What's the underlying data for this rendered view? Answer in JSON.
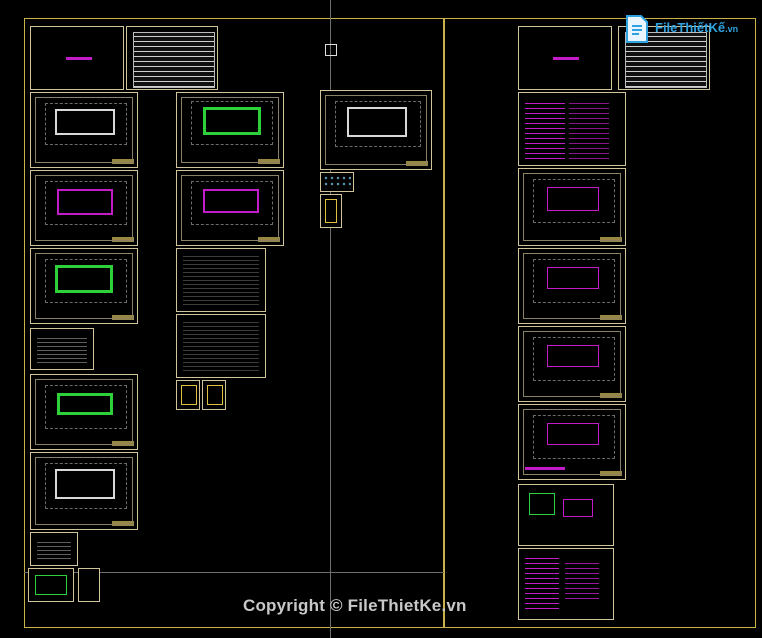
{
  "watermark": {
    "copyright_text": "Copyright © FileThietKe.vn",
    "logo_text": "FileThiếtKế",
    "logo_suffix": ".vn"
  },
  "colors": {
    "background": "#000000",
    "frame": "#c9b24a",
    "sheet_border": "#cfc49a",
    "wall_green": "#2fd13a",
    "wall_magenta": "#c21cc9",
    "logo_blue": "#2fa3e0"
  },
  "icons": {
    "logo": "file-document-icon",
    "crosshair": "cad-cursor-icon"
  }
}
